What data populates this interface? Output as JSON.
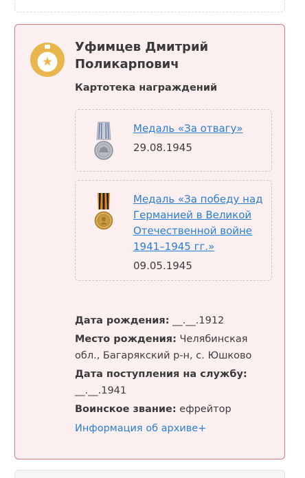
{
  "person": {
    "name": "Уфимцев Дмитрий Поликарпович",
    "section_title": "Картотека награждений"
  },
  "awards": [
    {
      "title": "Медаль «За отвагу»",
      "date": "29.08.1945",
      "medal_icon": "medal-for-courage-icon"
    },
    {
      "title": "Медаль «За победу над Германией в Великой Отечественной войне 1941–1945 гг.»",
      "date": "09.05.1945",
      "medal_icon": "medal-victory-over-germany-icon"
    }
  ],
  "details": {
    "birth_date_label": "Дата рождения:",
    "birth_date_value": "__.__.1912",
    "birth_place_label": "Место рождения:",
    "birth_place_value": "Челябинская обл., Багарякский р-н, с. Юшково",
    "service_start_label": "Дата поступления на службу:",
    "service_start_value": "__.__.1941",
    "rank_label": "Воинское звание:",
    "rank_value": "ефрейтор",
    "archive_link": "Информация об архиве+"
  },
  "colors": {
    "card_background": "#fbeff0",
    "card_border": "#d87a80",
    "link": "#2a7ed6",
    "badge": "#e8b64a"
  }
}
